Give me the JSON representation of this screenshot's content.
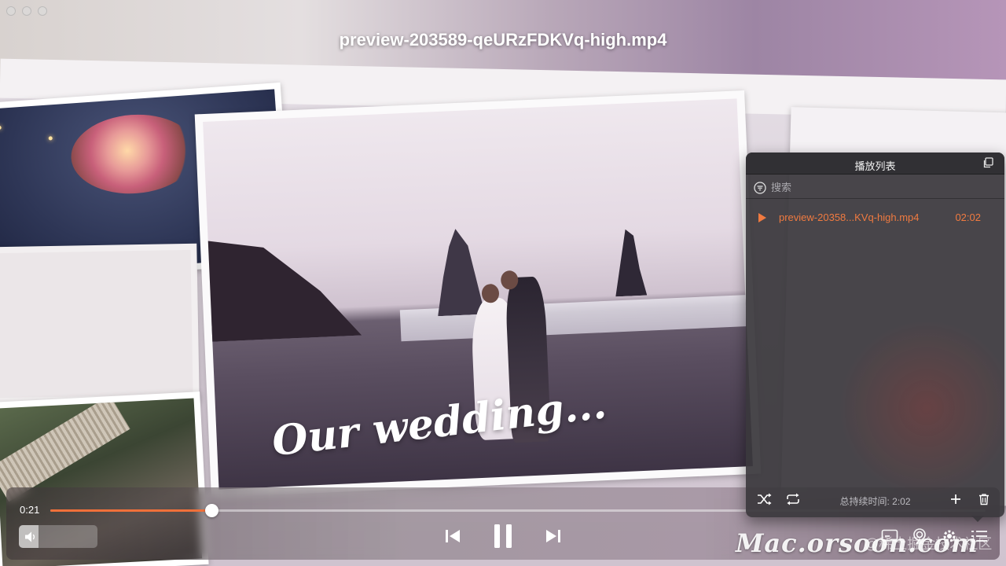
{
  "window": {
    "title": "preview-203589-qeURzFDKVq-high.mp4"
  },
  "video": {
    "overlay_text": "Our wedding..."
  },
  "player": {
    "time_elapsed": "0:21",
    "progress": 0.172,
    "volume": 0.25
  },
  "playlist": {
    "title": "播放列表",
    "search_placeholder": "搜索",
    "items": [
      {
        "name": "preview-20358...KVq-high.mp4",
        "duration": "02:02",
        "playing": true
      }
    ],
    "total_label": "总持续时间:",
    "total_value": "2:02"
  },
  "watermark": {
    "text": "Mac.orsoon.com",
    "subtext": "@稀土掘金技术社区"
  },
  "colors": {
    "accent": "#f0703a",
    "panel_bg": "#3a383c"
  },
  "icons": {
    "shuffle": "shuffle-icon",
    "repeat": "repeat-icon",
    "add": "plus-icon",
    "delete": "trash-icon",
    "filter": "filter-icon",
    "detach": "detach-window-icon",
    "prev": "skip-previous-icon",
    "pause": "pause-icon",
    "next": "skip-next-icon",
    "volume": "speaker-icon",
    "subtitle": "subtitle-icon",
    "airplay": "airplay-icon",
    "settings": "gear-icon",
    "playlist": "playlist-icon"
  }
}
